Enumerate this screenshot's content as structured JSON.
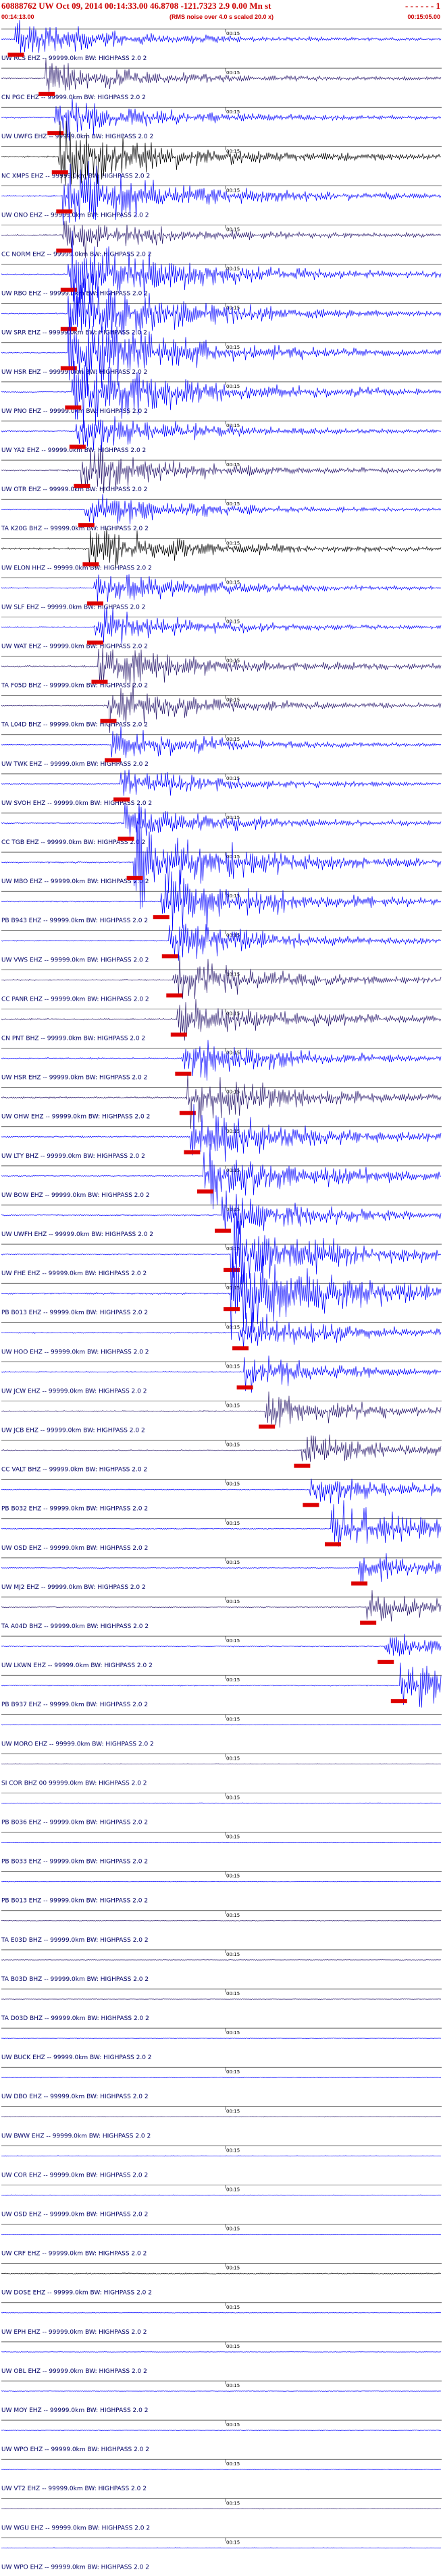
{
  "header": {
    "title": "60888762 UW Oct 09, 2014 00:14:33.00   46.8708  -121.7323   2.9 0.00 Mn st",
    "end_marker": "- - - - - - 1",
    "start_time": "00:14:13.00",
    "subtitle": "(RMS noise over 4.0 s scaled 20.0 x)",
    "end_time": "00:15:05.00"
  },
  "chart_data": {
    "type": "line",
    "title": "60888762 UW Oct 09, 2014 00:14:33.00   46.8708  -121.7323   2.9 0.00 Mn st",
    "tick_label": "00:15",
    "traces": [
      {
        "label": "UW RCS EHZ -- 99999.0km BW: HIGHPASS 2.0 2",
        "pick": 0.03,
        "color": "#0000ff",
        "eq": 1.1,
        "noise": 0.5
      },
      {
        "label": "CN PGC EHZ -- 99999.0km BW: HIGHPASS 2.0 2",
        "pick": 0.1,
        "color": "#2a1a6e",
        "eq": 1.0,
        "noise": 0.6
      },
      {
        "label": "UW UWFG EHZ -- 99999.0km BW: HIGHPASS 2.0 2",
        "pick": 0.12,
        "color": "#0000ff",
        "eq": 1.2,
        "noise": 0.6
      },
      {
        "label": "NC XMPS EHZ -- 99999.0km BW: HIGHPASS 2.0 2",
        "pick": 0.13,
        "color": "#000000",
        "eq": 2.0,
        "noise": 0.8
      },
      {
        "label": "UW ONO EHZ -- 99999.0km BW: HIGHPASS 2.0 2",
        "pick": 0.14,
        "color": "#0000ff",
        "eq": 2.2,
        "noise": 0.7
      },
      {
        "label": "CC NORM EHZ -- 99999.0km BW: HIGHPASS 2.0 2",
        "pick": 0.14,
        "color": "#2a1a6e",
        "eq": 1.2,
        "noise": 0.7
      },
      {
        "label": "UW RBO EHZ -- 99999.0km BW: HIGHPASS 2.0 2",
        "pick": 0.15,
        "color": "#0000ff",
        "eq": 2.4,
        "noise": 0.6
      },
      {
        "label": "UW SRR EHZ -- 99999.0km BW: HIGHPASS 2.0 2",
        "pick": 0.15,
        "color": "#0000ff",
        "eq": 2.4,
        "noise": 0.6
      },
      {
        "label": "UW HSR EHZ -- 99999.0km BW: HIGHPASS 2.0 2",
        "pick": 0.15,
        "color": "#0000ff",
        "eq": 2.5,
        "noise": 0.6
      },
      {
        "label": "UW PNO EHZ -- 99999.0km BW: HIGHPASS 2.0 2",
        "pick": 0.16,
        "color": "#0000ff",
        "eq": 2.4,
        "noise": 0.6
      },
      {
        "label": "UW YA2 EHZ -- 99999.0km BW: HIGHPASS 2.0 2",
        "pick": 0.17,
        "color": "#0000ff",
        "eq": 1.2,
        "noise": 0.6
      },
      {
        "label": "UW OTR EHZ -- 99999.0km BW: HIGHPASS 2.0 2",
        "pick": 0.18,
        "color": "#2a1a6e",
        "eq": 1.3,
        "noise": 0.8
      },
      {
        "label": "TA K20G BHZ -- 99999.0km BW: HIGHPASS 2.0 2",
        "pick": 0.19,
        "color": "#0000ff",
        "eq": 1.1,
        "noise": 0.5
      },
      {
        "label": "UW ELON HHZ -- 99999.0km BW: HIGHPASS 2.0 2",
        "pick": 0.2,
        "color": "#000000",
        "eq": 1.3,
        "noise": 1.0
      },
      {
        "label": "UW SLF EHZ -- 99999.0km BW: HIGHPASS 2.0 2",
        "pick": 0.21,
        "color": "#0000ff",
        "eq": 1.1,
        "noise": 0.5
      },
      {
        "label": "UW WAT EHZ -- 99999.0km BW: HIGHPASS 2.0 2",
        "pick": 0.21,
        "color": "#0000ff",
        "eq": 1.1,
        "noise": 0.5
      },
      {
        "label": "TA F05D BHZ -- 99999.0km BW: HIGHPASS 2.0 2",
        "pick": 0.22,
        "color": "#2a1a6e",
        "eq": 1.6,
        "noise": 0.8
      },
      {
        "label": "TA L04D BHZ -- 99999.0km BW: HIGHPASS 2.0 2",
        "pick": 0.24,
        "color": "#2a1a6e",
        "eq": 1.3,
        "noise": 0.6
      },
      {
        "label": "UW TWK EHZ -- 99999.0km BW: HIGHPASS 2.0 2",
        "pick": 0.25,
        "color": "#0000ff",
        "eq": 1.0,
        "noise": 0.4
      },
      {
        "label": "UW SVOH EHZ -- 99999.0km BW: HIGHPASS 2.0 2",
        "pick": 0.27,
        "color": "#0000ff",
        "eq": 1.0,
        "noise": 0.4
      },
      {
        "label": "CC TGB EHZ -- 99999.0km BW: HIGHPASS 2.0 2",
        "pick": 0.28,
        "color": "#0000ff",
        "eq": 1.2,
        "noise": 0.6
      },
      {
        "label": "UW MBO EHZ -- 99999.0km BW: HIGHPASS 2.0 2",
        "pick": 0.3,
        "color": "#0000ff",
        "eq": 2.4,
        "noise": 0.8
      },
      {
        "label": "PB B943 EHZ -- 99999.0km BW: HIGHPASS 2.0 2",
        "pick": 0.36,
        "color": "#0000ff",
        "eq": 2.0,
        "noise": 0.6
      },
      {
        "label": "UW VWS EHZ -- 99999.0km BW: HIGHPASS 2.0 2",
        "pick": 0.38,
        "color": "#0000ff",
        "eq": 1.2,
        "noise": 0.5
      },
      {
        "label": "CC PANR EHZ -- 99999.0km BW: HIGHPASS 2.0 2",
        "pick": 0.39,
        "color": "#2a1a6e",
        "eq": 1.3,
        "noise": 0.6
      },
      {
        "label": "CN PNT BHZ -- 99999.0km BW: HIGHPASS 2.0 2",
        "pick": 0.4,
        "color": "#2a1a6e",
        "eq": 1.4,
        "noise": 0.8
      },
      {
        "label": "UW HSR EHZ -- 99999.0km BW: HIGHPASS 2.0 2",
        "pick": 0.41,
        "color": "#0000ff",
        "eq": 1.3,
        "noise": 0.7
      },
      {
        "label": "UW OHW EHZ -- 99999.0km BW: HIGHPASS 2.0 2",
        "pick": 0.42,
        "color": "#2a1a6e",
        "eq": 1.5,
        "noise": 0.9
      },
      {
        "label": "UW LTY BHZ -- 99999.0km BW: HIGHPASS 2.0 2",
        "pick": 0.43,
        "color": "#0000ff",
        "eq": 1.6,
        "noise": 0.8
      },
      {
        "label": "UW BOW EHZ -- 99999.0km BW: HIGHPASS 2.0 2",
        "pick": 0.46,
        "color": "#0000ff",
        "eq": 1.8,
        "noise": 0.6
      },
      {
        "label": "UW UWFH EHZ -- 99999.0km BW: HIGHPASS 2.0 2",
        "pick": 0.5,
        "color": "#0000ff",
        "eq": 1.4,
        "noise": 0.6
      },
      {
        "label": "UW FHE EHZ -- 99999.0km BW: HIGHPASS 2.0 2",
        "pick": 0.52,
        "color": "#0000ff",
        "eq": 2.2,
        "noise": 0.6
      },
      {
        "label": "PB B013 EHZ -- 99999.0km BW: HIGHPASS 2.0 2",
        "pick": 0.52,
        "color": "#0000ff",
        "eq": 2.6,
        "noise": 0.8
      },
      {
        "label": "UW HOO EHZ -- 99999.0km BW: HIGHPASS 2.0 2",
        "pick": 0.54,
        "color": "#0000ff",
        "eq": 1.2,
        "noise": 0.6
      },
      {
        "label": "UW JCW EHZ -- 99999.0km BW: HIGHPASS 2.0 2",
        "pick": 0.55,
        "color": "#0000ff",
        "eq": 1.0,
        "noise": 0.6
      },
      {
        "label": "UW JCB EHZ -- 99999.0km BW: HIGHPASS 2.0 2",
        "pick": 0.6,
        "color": "#2a1a6e",
        "eq": 1.0,
        "noise": 0.6
      },
      {
        "label": "CC VALT BHZ -- 99999.0km BW: HIGHPASS 2.0 2",
        "pick": 0.68,
        "color": "#2a1a6e",
        "eq": 1.0,
        "noise": 0.6
      },
      {
        "label": "PB B032 EHZ -- 99999.0km BW: HIGHPASS 2.0 2",
        "pick": 0.7,
        "color": "#0000ff",
        "eq": 0.9,
        "noise": 0.5
      },
      {
        "label": "UW OSD EHZ -- 99999.0km BW: HIGHPASS 2.0 2",
        "pick": 0.75,
        "color": "#0000ff",
        "eq": 1.4,
        "noise": 0.5
      },
      {
        "label": "UW MJ2 EHZ -- 99999.0km BW: HIGHPASS 2.0 2",
        "pick": 0.81,
        "color": "#0000ff",
        "eq": 0.9,
        "noise": 0.5
      },
      {
        "label": "TA A04D BHZ -- 99999.0km BW: HIGHPASS 2.0 2",
        "pick": 0.83,
        "color": "#2a1a6e",
        "eq": 0.9,
        "noise": 0.5
      },
      {
        "label": "UW LKWN EHZ -- 99999.0km BW: HIGHPASS 2.0 2",
        "pick": 0.87,
        "color": "#0000ff",
        "eq": 0.9,
        "noise": 0.5
      },
      {
        "label": "PB B937 EHZ -- 99999.0km BW: HIGHPASS 2.0 2",
        "pick": 0.9,
        "color": "#0000ff",
        "eq": 1.6,
        "noise": 0.5
      },
      {
        "label": "UW MORO EHZ -- 99999.0km BW: HIGHPASS 2.0 2",
        "pick": null,
        "color": "#0000ff",
        "eq": 0,
        "noise": 0.3
      },
      {
        "label": "SI COR BHZ 00 99999.0km BW: HIGHPASS 2.0 2",
        "pick": null,
        "color": "#2a1a6e",
        "eq": 0,
        "noise": 0.3
      },
      {
        "label": "PB B036 EHZ -- 99999.0km BW: HIGHPASS 2.0 2",
        "pick": null,
        "color": "#0000ff",
        "eq": 0,
        "noise": 0.3
      },
      {
        "label": "PB B033 EHZ -- 99999.0km BW: HIGHPASS 2.0 2",
        "pick": null,
        "color": "#0000ff",
        "eq": 0,
        "noise": 0.3
      },
      {
        "label": "PB B013 EHZ -- 99999.0km BW: HIGHPASS 2.0 2",
        "pick": null,
        "color": "#0000ff",
        "eq": 0,
        "noise": 0.3
      },
      {
        "label": "TA E03D BHZ -- 99999.0km BW: HIGHPASS 2.0 2",
        "pick": null,
        "color": "#2a1a6e",
        "eq": 0.5,
        "noise": 0.3
      },
      {
        "label": "TA B03D BHZ -- 99999.0km BW: HIGHPASS 2.0 2",
        "pick": null,
        "color": "#2a1a6e",
        "eq": 0,
        "noise": 0.3
      },
      {
        "label": "TA D03D BHZ -- 99999.0km BW: HIGHPASS 2.0 2",
        "pick": null,
        "color": "#2a1a6e",
        "eq": 0,
        "noise": 0.3
      },
      {
        "label": "UW BUCK EHZ -- 99999.0km BW: HIGHPASS 2.0 2",
        "pick": null,
        "color": "#0000ff",
        "eq": 0,
        "noise": 0.3
      },
      {
        "label": "UW DBO EHZ -- 99999.0km BW: HIGHPASS 2.0 2",
        "pick": null,
        "color": "#0000ff",
        "eq": 0,
        "noise": 0.3
      },
      {
        "label": "UW BWW EHZ -- 99999.0km BW: HIGHPASS 2.0 2",
        "pick": null,
        "color": "#2a1a6e",
        "eq": 0,
        "noise": 0.3
      },
      {
        "label": "UW COR EHZ -- 99999.0km BW: HIGHPASS 2.0 2",
        "pick": null,
        "color": "#0000ff",
        "eq": 0,
        "noise": 0.3
      },
      {
        "label": "UW OSD EHZ -- 99999.0km BW: HIGHPASS 2.0 2",
        "pick": null,
        "color": "#0000ff",
        "eq": 0,
        "noise": 0.3
      },
      {
        "label": "UW CRF EHZ -- 99999.0km BW: HIGHPASS 2.0 2",
        "pick": null,
        "color": "#0000ff",
        "eq": 0,
        "noise": 0.3
      },
      {
        "label": "UW DOSE EHZ -- 99999.0km BW: HIGHPASS 2.0 2",
        "pick": null,
        "color": "#000000",
        "eq": 0,
        "noise": 0.6
      },
      {
        "label": "UW EPH EHZ -- 99999.0km BW: HIGHPASS 2.0 2",
        "pick": null,
        "color": "#0000ff",
        "eq": 0,
        "noise": 0.3
      },
      {
        "label": "UW OBL EHZ -- 99999.0km BW: HIGHPASS 2.0 2",
        "pick": null,
        "color": "#0000ff",
        "eq": 0,
        "noise": 0.3
      },
      {
        "label": "UW MOY EHZ -- 99999.0km BW: HIGHPASS 2.0 2",
        "pick": null,
        "color": "#0000ff",
        "eq": 0,
        "noise": 0.3
      },
      {
        "label": "UW WPO EHZ -- 99999.0km BW: HIGHPASS 2.0 2",
        "pick": null,
        "color": "#0000ff",
        "eq": 0,
        "noise": 0.3
      },
      {
        "label": "UW VT2 EHZ -- 99999.0km BW: HIGHPASS 2.0 2",
        "pick": null,
        "color": "#0000ff",
        "eq": 0,
        "noise": 0.3
      },
      {
        "label": "UW WGU EHZ -- 99999.0km BW: HIGHPASS 2.0 2",
        "pick": null,
        "color": "#2a1a6e",
        "eq": 0,
        "noise": 0.3
      },
      {
        "label": "UW WPO EHZ -- 99999.0km BW: HIGHPASS 2.0 2",
        "pick": null,
        "color": "#0000ff",
        "eq": 0,
        "noise": 0.3
      }
    ]
  },
  "colors": {
    "title": "#cc0000",
    "pick": "#dd0000",
    "tick": "#000000",
    "label": "#000066"
  }
}
